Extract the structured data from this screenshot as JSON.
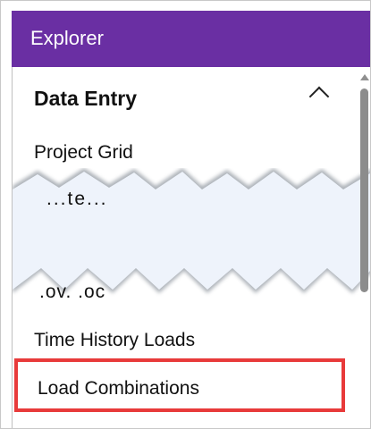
{
  "header": {
    "title": "Explorer"
  },
  "tree": {
    "section_title": "Data Entry",
    "section_toggle_icon": "chevron-up-icon",
    "items": [
      {
        "label": "Project Grid"
      },
      {
        "label": "Time History Loads"
      },
      {
        "label": "Load Combinations"
      }
    ],
    "partial_top": "...te...",
    "partial_bottom": ".ov.  .oc"
  },
  "colors": {
    "header_bg": "#6a2fa3",
    "highlight": "#e83a3a",
    "torn_area": "#eef3fb"
  }
}
